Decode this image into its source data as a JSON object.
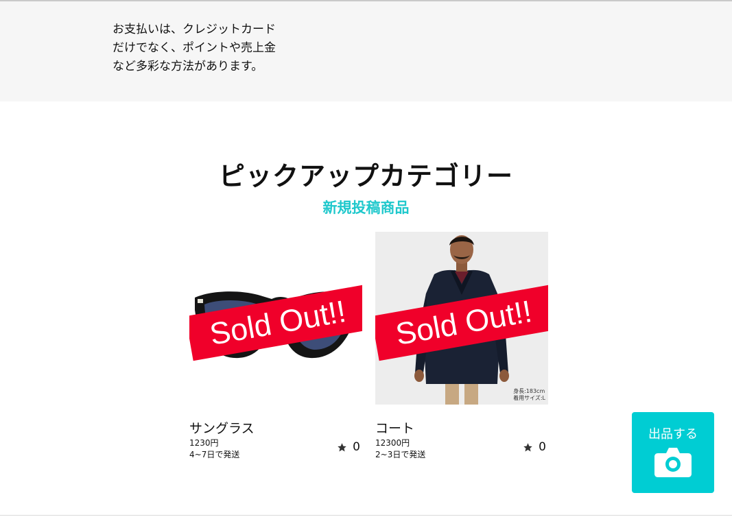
{
  "payment_info": {
    "lines": [
      "お支払いは、クレジットカード",
      "だけでなく、ポイントや売上金",
      "など多彩な方法があります。"
    ]
  },
  "pickup": {
    "title": "ピックアップカテゴリー",
    "subtitle": "新規投稿商品"
  },
  "products": [
    {
      "name": "サングラス",
      "price": "1230円",
      "shipping": "4~7日で発送",
      "sold_label": "Sold Out!!",
      "likes": "0",
      "image_icon": "sunglasses-image"
    },
    {
      "name": "コート",
      "price": "12300円",
      "shipping": "2~3日で発送",
      "sold_label": "Sold Out!!",
      "likes": "0",
      "image_icon": "coat-model-image",
      "image_caption": [
        "身長:183cm",
        "着用サイズ:L"
      ]
    }
  ],
  "sell_button": {
    "label": "出品する",
    "icon": "camera-icon"
  },
  "colors": {
    "accent": "#00cdd3",
    "subtitle": "#1fc8cc",
    "sold_out": "#f0002a",
    "band_bg": "#f6f6f6"
  }
}
